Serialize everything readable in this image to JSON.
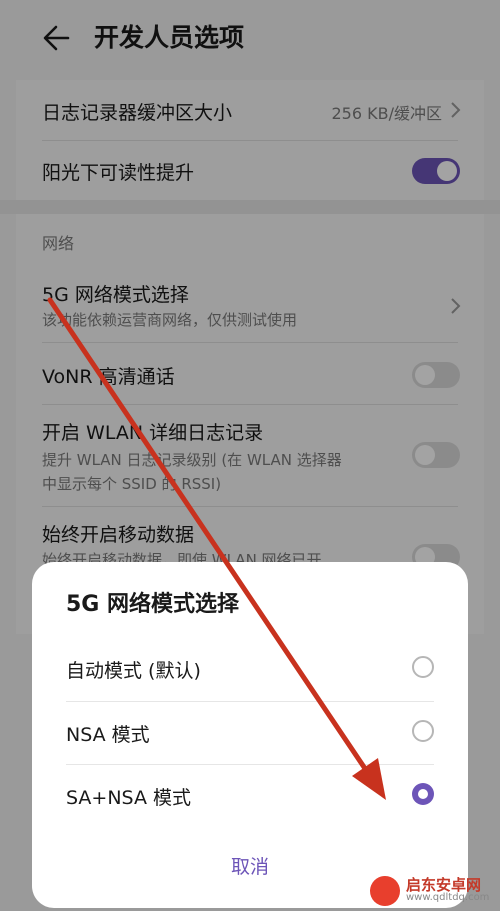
{
  "header": {
    "title": "开发人员选项"
  },
  "settings": {
    "log_buffer": {
      "label": "日志记录器缓冲区大小",
      "value": "256 KB/缓冲区"
    },
    "sunlight": {
      "label": "阳光下可读性提升",
      "on": true
    },
    "network_section": "网络",
    "mode_5g": {
      "label": "5G 网络模式选择",
      "sub": "该功能依赖运营商网络，仅供测试使用"
    },
    "vonr": {
      "label": "VoNR 高清通话",
      "on": false
    },
    "wlan_log": {
      "label": "开启 WLAN 详细日志记录",
      "sub_line1": "提升 WLAN 日志记录级别 (在 WLAN 选择器",
      "sub_line2": "中显示每个 SSID 的 RSSI)",
      "on": false
    },
    "mobile_data": {
      "label": "始终开启移动数据",
      "sub": "始终开启移动数据，即使 WLAN 网络已开",
      "on": false
    }
  },
  "dialog": {
    "title": "5G 网络模式选择",
    "options": [
      {
        "label": "自动模式 (默认)",
        "selected": false
      },
      {
        "label": "NSA 模式",
        "selected": false
      },
      {
        "label": "SA+NSA 模式",
        "selected": true
      }
    ],
    "cancel_label": "取消"
  },
  "watermark": {
    "text": "启东安卓网",
    "url": "www.qdltdq.com"
  },
  "colors": {
    "accent": "#6d55b8",
    "arrow": "#c8321e"
  }
}
